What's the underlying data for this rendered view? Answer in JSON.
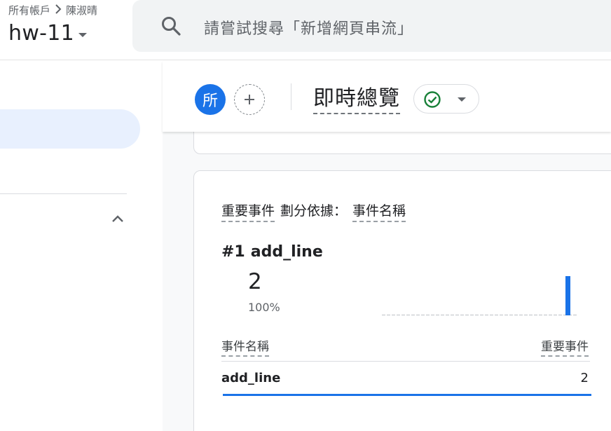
{
  "header": {
    "breadcrumb": {
      "root": "所有帳戶",
      "separator_icon": "chevron-right-icon",
      "account": "陳淑晴"
    },
    "property_name": "hw-11",
    "search": {
      "placeholder": "請嘗試搜尋「新增網頁串流」",
      "icon": "search-icon"
    }
  },
  "sidebar": {
    "collapse_icon": "chevron-up-icon"
  },
  "report_header": {
    "comparison_chip": "所",
    "add_comparison_icon": "plus-icon",
    "title": "即時總覽",
    "status_icon": "check-circle-icon",
    "dropdown_icon": "arrow-drop-down-icon"
  },
  "key_events_card": {
    "metric_label": "重要事件",
    "dimension_prefix": "劃分依據：",
    "dimension_label": "事件名稱",
    "top_rank": "#1",
    "top_item": "add_line",
    "top_value": "2",
    "top_percent": "100%",
    "table": {
      "headers": [
        "事件名稱",
        "重要事件"
      ],
      "rows": [
        {
          "name": "add_line",
          "value": "2",
          "bar_fraction": 1.0
        }
      ]
    }
  },
  "colors": {
    "accent": "#1a73e8",
    "active_nav": "#e8f0fe",
    "search_bg": "#f1f3f4",
    "status_ok": "#188038"
  }
}
